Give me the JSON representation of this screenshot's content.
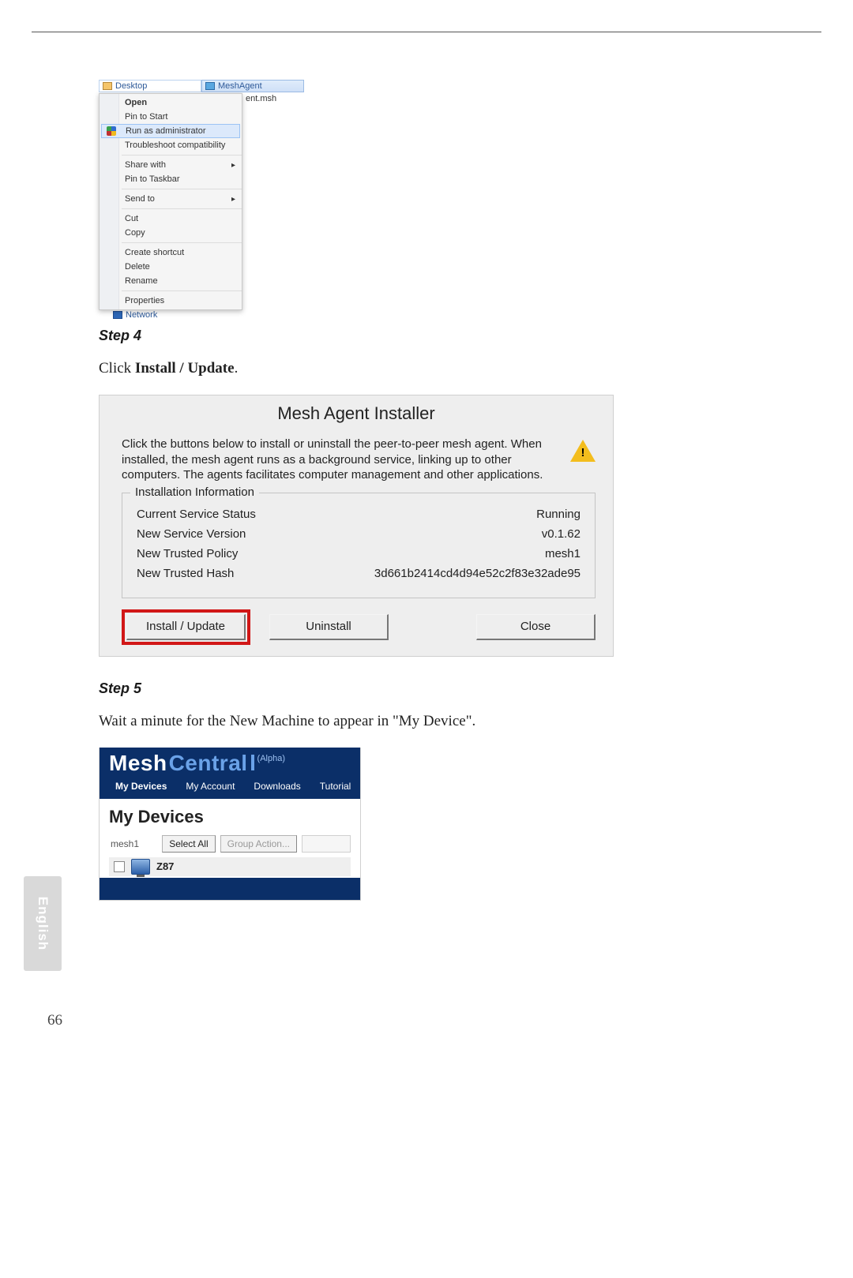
{
  "side_tab": "English",
  "page_number": "66",
  "fig1": {
    "top_left": "Desktop",
    "top_right": "MeshAgent",
    "side_file": "ent.msh",
    "low_label": "Network",
    "items": {
      "open": "Open",
      "pin_start": "Pin to Start",
      "run_admin": "Run as administrator",
      "troubleshoot": "Troubleshoot compatibility",
      "share_with": "Share with",
      "pin_taskbar": "Pin to Taskbar",
      "send_to": "Send to",
      "cut": "Cut",
      "copy": "Copy",
      "create_shortcut": "Create shortcut",
      "delete": "Delete",
      "rename": "Rename",
      "properties": "Properties"
    }
  },
  "step4": {
    "heading": "Step 4",
    "text_prefix": "Click ",
    "text_bold": "Install / Update",
    "text_suffix": "."
  },
  "installer": {
    "title": "Mesh Agent Installer",
    "description": "Click the buttons below to install or uninstall the peer-to-peer mesh agent. When installed, the mesh agent runs as a background service, linking up to other computers. The agents facilitates computer management and other applications.",
    "group_title": "Installation Information",
    "rows": {
      "status_label": "Current Service Status",
      "status_value": "Running",
      "version_label": "New Service Version",
      "version_value": "v0.1.62",
      "policy_label": "New Trusted Policy",
      "policy_value": "mesh1",
      "hash_label": "New Trusted Hash",
      "hash_value": "3d661b2414cd4d94e52c2f83e32ade95"
    },
    "buttons": {
      "install": "Install / Update",
      "uninstall": "Uninstall",
      "close": "Close"
    }
  },
  "step5": {
    "heading": "Step 5",
    "text": "Wait a minute for the New Machine to appear in \"My Device\"."
  },
  "meshweb": {
    "logo_mesh": "Mesh",
    "logo_central": "Central",
    "logo_alpha": "(Alpha)",
    "tabs": {
      "my_devices": "My Devices",
      "my_account": "My Account",
      "downloads": "Downloads",
      "tutorial": "Tutorial"
    },
    "body_title": "My Devices",
    "mesh_name": "mesh1",
    "select_all": "Select All",
    "group_action": "Group Action...",
    "device_name": "Z87"
  }
}
